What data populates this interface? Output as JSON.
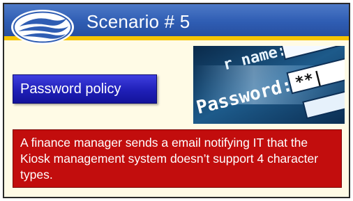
{
  "slide": {
    "title": "Scenario # 5",
    "policy_button_label": "Password policy",
    "message": "A finance manager sends a email notifying IT that the Kiosk management system doesn’t support 4 character types.",
    "photo": {
      "username_label": "r name:",
      "password_label": "Password:",
      "masked_value": "**|"
    }
  },
  "colors": {
    "header_blue": "#2f5db3",
    "header_stripe": "#f5c400",
    "slide_background": "#fffbe6",
    "button_blue": "#1f1fb7",
    "message_red": "#c20d0d"
  },
  "icons": {
    "logo": "swoosh-logo-icon"
  }
}
